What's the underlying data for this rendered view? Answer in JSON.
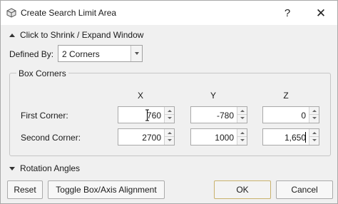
{
  "window": {
    "title": "Create Search Limit Area",
    "help_label": "?",
    "close_label": "✕"
  },
  "collapse": {
    "label": "Click to Shrink / Expand Window"
  },
  "defined_by": {
    "label": "Defined By:",
    "value": "2 Corners"
  },
  "box_corners": {
    "title": "Box Corners",
    "columns": [
      "X",
      "Y",
      "Z"
    ],
    "rows": [
      {
        "label": "First Corner:",
        "values": [
          "760",
          "-780",
          "0"
        ]
      },
      {
        "label": "Second Corner:",
        "values": [
          "2700",
          "1000",
          "1,650"
        ]
      }
    ]
  },
  "rotation": {
    "label": "Rotation Angles"
  },
  "buttons": {
    "reset": "Reset",
    "toggle": "Toggle Box/Axis Alignment",
    "ok": "OK",
    "cancel": "Cancel"
  },
  "colors": {
    "accent_ok_border": "#c9b26d",
    "window_bg": "#f0f0f0"
  }
}
